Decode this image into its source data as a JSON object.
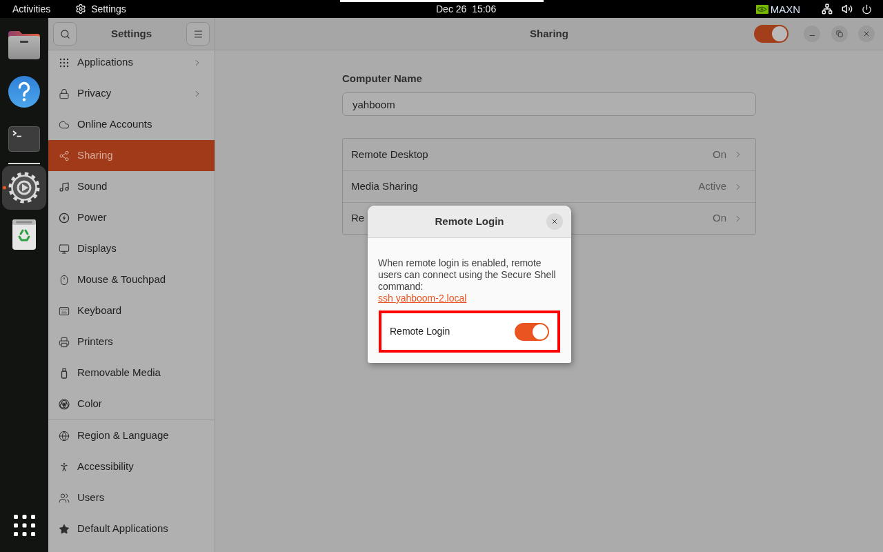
{
  "top_bar": {
    "activities": "Activities",
    "app_menu": "Settings",
    "clock": "Dec 26  15:06",
    "power_mode": "MAXN"
  },
  "dock": {
    "items": [
      {
        "selected": false,
        "running": false
      },
      {
        "selected": false,
        "running": false
      },
      {
        "selected": false,
        "running": false
      },
      {
        "selected": true,
        "running": true
      },
      {
        "selected": false,
        "running": false
      }
    ]
  },
  "settings_window": {
    "sidebar": {
      "title": "Settings",
      "groups": [
        {
          "items": [
            {
              "label": "Applications",
              "selected": false,
              "submenu": true
            },
            {
              "label": "Privacy",
              "selected": false,
              "submenu": true
            },
            {
              "label": "Online Accounts",
              "selected": false,
              "submenu": false
            },
            {
              "label": "Sharing",
              "selected": true,
              "submenu": false
            },
            {
              "label": "Sound",
              "selected": false,
              "submenu": false
            },
            {
              "label": "Power",
              "selected": false,
              "submenu": false
            },
            {
              "label": "Displays",
              "selected": false,
              "submenu": false
            },
            {
              "label": "Mouse & Touchpad",
              "selected": false,
              "submenu": false
            },
            {
              "label": "Keyboard",
              "selected": false,
              "submenu": false
            },
            {
              "label": "Printers",
              "selected": false,
              "submenu": false
            },
            {
              "label": "Removable Media",
              "selected": false,
              "submenu": false
            },
            {
              "label": "Color",
              "selected": false,
              "submenu": false
            }
          ]
        },
        {
          "items": [
            {
              "label": "Region & Language",
              "selected": false,
              "submenu": false
            },
            {
              "label": "Accessibility",
              "selected": false,
              "submenu": false
            },
            {
              "label": "Users",
              "selected": false,
              "submenu": false
            },
            {
              "label": "Default Applications",
              "selected": false,
              "submenu": false
            }
          ]
        }
      ]
    },
    "header": {
      "title": "Sharing",
      "sharing_on": true
    },
    "computer_name": {
      "label": "Computer Name",
      "value": "yahboom"
    },
    "services": [
      {
        "label": "Remote Desktop",
        "status": "On"
      },
      {
        "label": "Media Sharing",
        "status": "Active"
      },
      {
        "label": "Re",
        "status": "On"
      }
    ]
  },
  "dialog": {
    "title": "Remote Login",
    "description": "When remote login is enabled, remote users can connect using the Secure Shell command:",
    "command": "ssh yahboom-2.local",
    "toggle": {
      "label": "Remote Login",
      "on": true,
      "highlighted": true
    }
  }
}
